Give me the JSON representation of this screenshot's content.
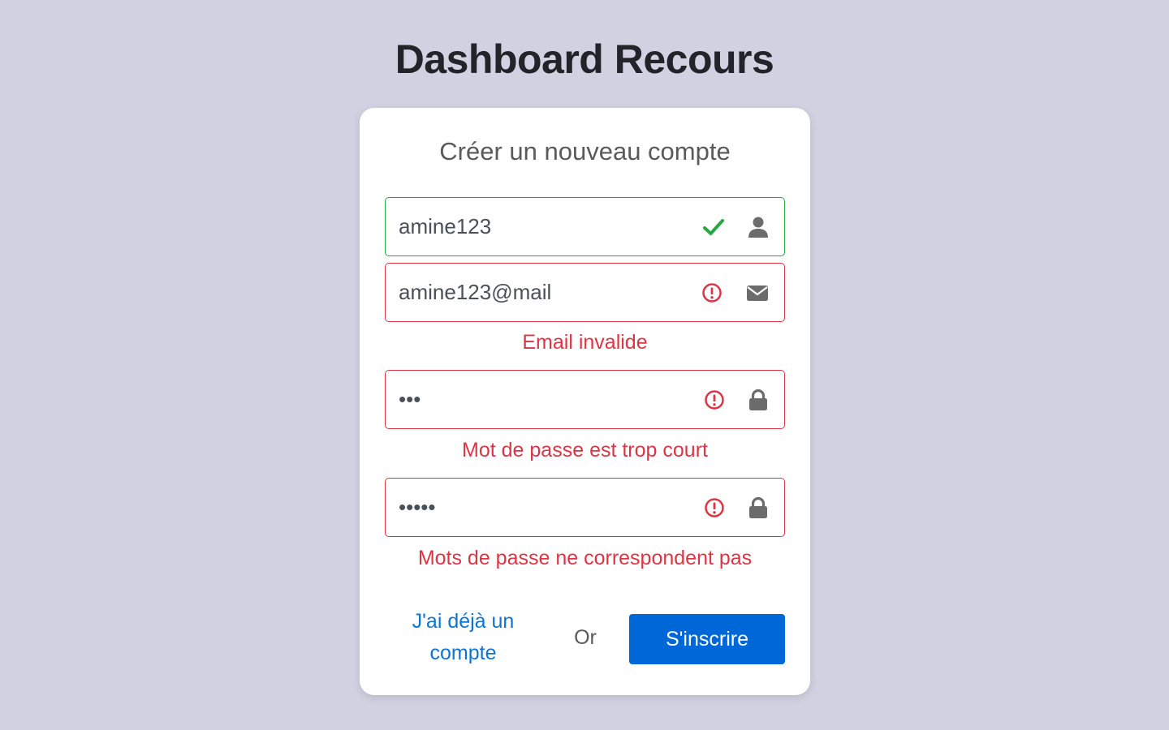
{
  "app": {
    "title": "Dashboard Recours"
  },
  "form": {
    "title": "Créer un nouveau compte",
    "username": {
      "value": "amine123",
      "status": "valid",
      "status_icon": "check-icon",
      "icon": "user-icon"
    },
    "email": {
      "value": "amine123@mail",
      "status": "invalid",
      "status_icon": "error-circle-icon",
      "icon": "envelope-icon",
      "error": "Email invalide"
    },
    "password": {
      "value": "•••",
      "status": "invalid",
      "status_icon": "error-circle-icon",
      "icon": "lock-icon",
      "error": "Mot de passe est trop court"
    },
    "confirm_password": {
      "value": "•••••",
      "status": "invalid",
      "status_icon": "error-circle-icon",
      "icon": "lock-icon",
      "error": "Mots de passe ne correspondent pas"
    },
    "login_link": "J'ai déjà un compte",
    "or_text": "Or",
    "submit_label": "S'inscrire"
  },
  "colors": {
    "background": "#d2d1e1",
    "valid": "#28a745",
    "error": "#dc3545",
    "link": "#0d74d4",
    "primary_button": "#0067d8",
    "icon": "#6c6c6c"
  }
}
